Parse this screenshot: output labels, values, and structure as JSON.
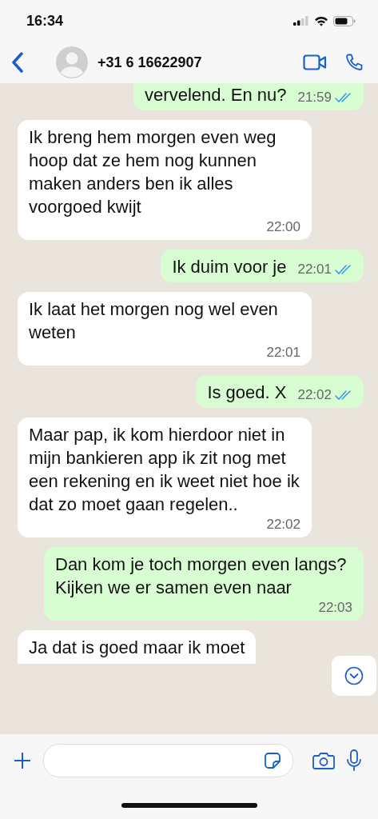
{
  "status_bar": {
    "time": "16:34"
  },
  "header": {
    "contact": "+31 6 16622907"
  },
  "messages": [
    {
      "kind": "out",
      "text": "vervelend. En nu?",
      "time": "21:59",
      "read": true
    },
    {
      "kind": "in",
      "text": "Ik breng hem morgen even weg hoop dat ze hem nog kunnen maken anders ben ik alles voorgoed kwijt",
      "time": "22:00"
    },
    {
      "kind": "out",
      "text": "Ik duim voor je",
      "time": "22:01",
      "read": true
    },
    {
      "kind": "in",
      "text": "Ik laat het morgen nog wel even weten",
      "time": "22:01"
    },
    {
      "kind": "out",
      "text": "Is goed. X",
      "time": "22:02",
      "read": true
    },
    {
      "kind": "in",
      "text": "Maar pap,  ik kom hierdoor niet in mijn bankieren app ik zit nog met een rekening en ik weet niet hoe ik dat zo moet gaan regelen..",
      "time": "22:02"
    },
    {
      "kind": "out",
      "text": "Dan kom je toch morgen even langs? Kijken we er samen even naar",
      "time": "22:03"
    },
    {
      "kind": "in",
      "text": "Ja dat is goed maar ik moet"
    }
  ]
}
